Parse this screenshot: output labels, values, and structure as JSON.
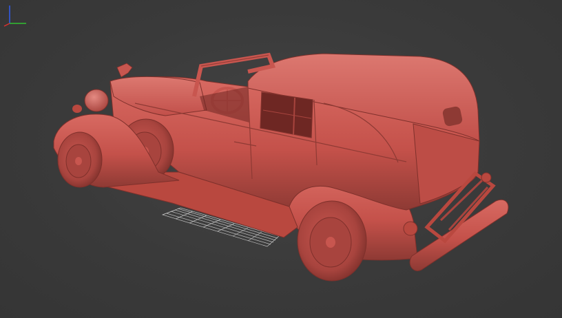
{
  "viewport": {
    "background_color": "#3b3b3b",
    "model_color": "#c8564f",
    "model_shadow_color": "#8e3a34",
    "model_highlight_color": "#dd7a72",
    "grid_color": "#d8d8d8"
  },
  "axis_gizmo": {
    "x_color": "#e03030",
    "y_color": "#30c030",
    "z_color": "#3060ff"
  }
}
